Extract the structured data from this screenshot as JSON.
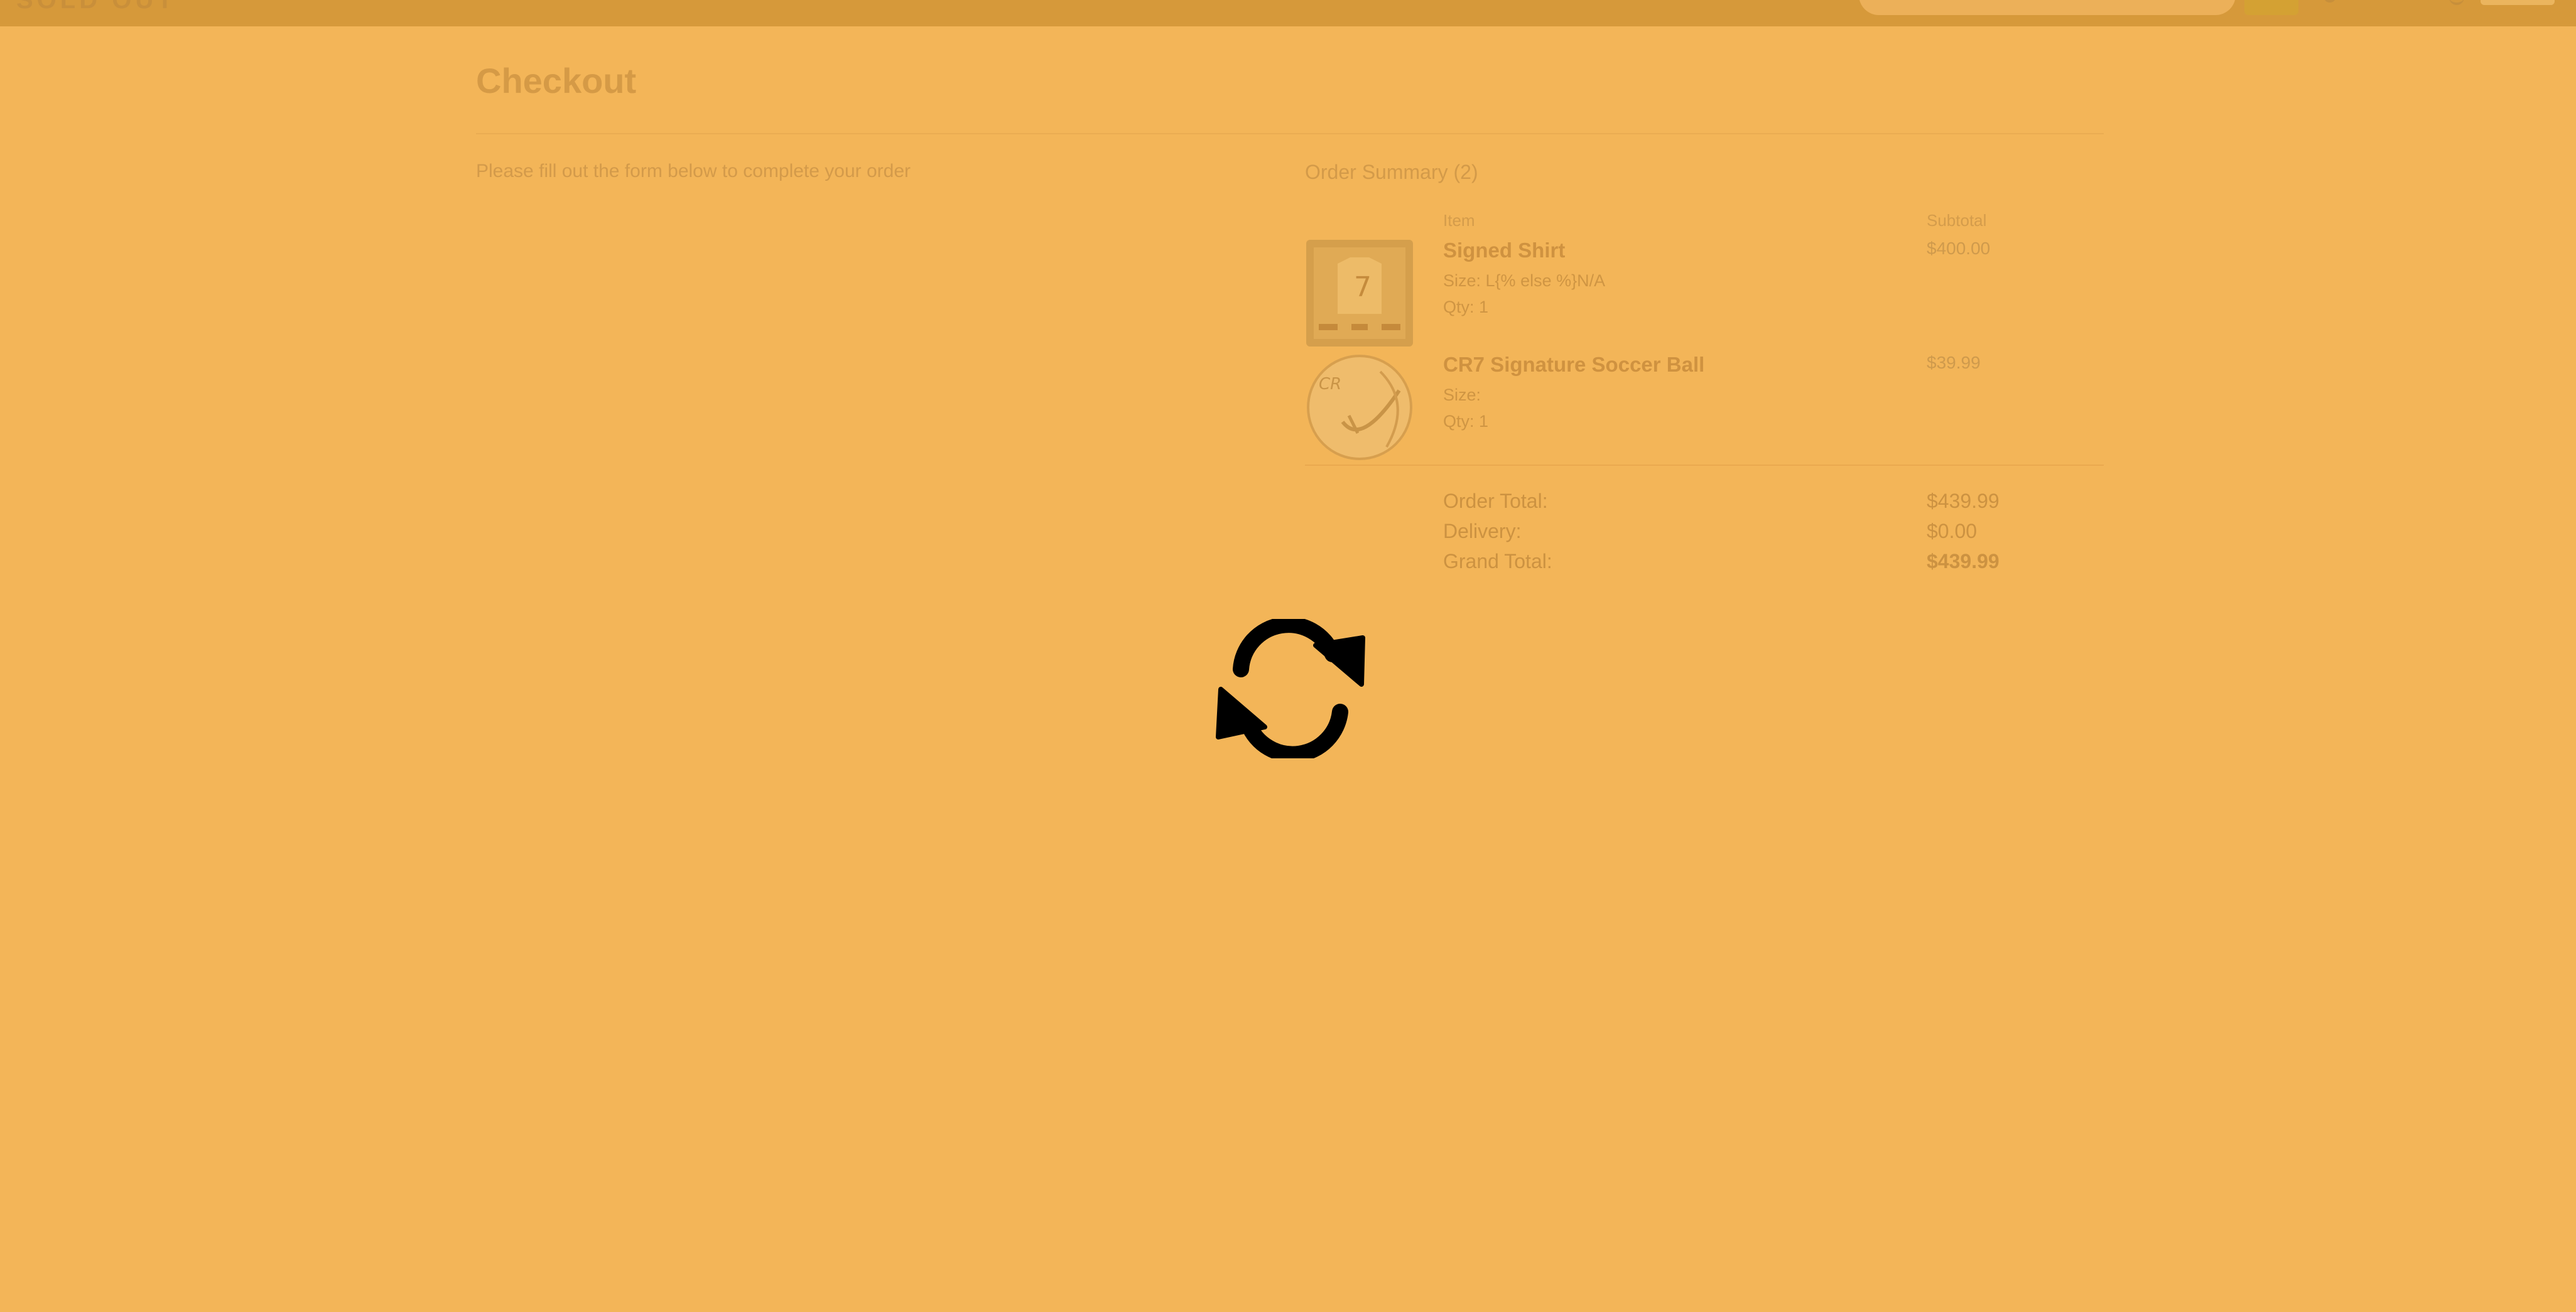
{
  "header": {
    "brand": "SOLD OUT",
    "search_placeholder": ""
  },
  "checkout": {
    "title": "Checkout",
    "intro": "Please fill out the form below to complete your order"
  },
  "summary": {
    "heading": "Order Summary (2)",
    "column_item": "Item",
    "column_subtotal": "Subtotal",
    "items": [
      {
        "name": "Signed Shirt",
        "size": "Size: L{% else %}N/A",
        "qty": "Qty: 1",
        "price": "$400.00",
        "thumb_icon": "signed-shirt-frame-image"
      },
      {
        "name": "CR7 Signature Soccer Ball",
        "size": "Size:",
        "qty": "Qty: 1",
        "price": "$39.99",
        "thumb_icon": "soccer-ball-image"
      }
    ],
    "order_total_label": "Order Total:",
    "order_total": "$439.99",
    "delivery_label": "Delivery:",
    "delivery": "$0.00",
    "grand_total_label": "Grand Total:",
    "grand_total": "$439.99"
  },
  "overlay": {
    "icon": "refresh-spinner-icon",
    "color": "#000000",
    "background": "#f3b558"
  }
}
